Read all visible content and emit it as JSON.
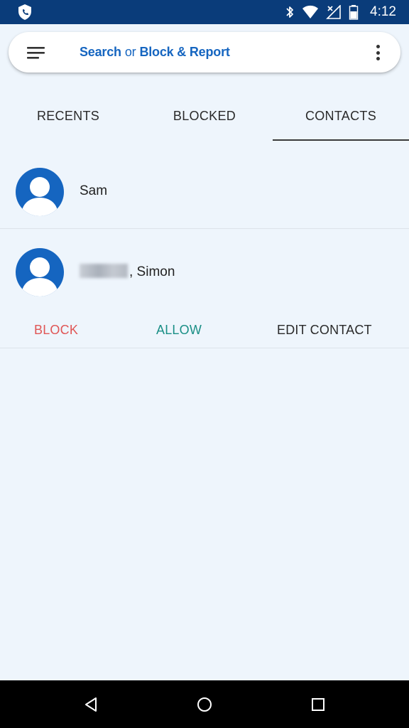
{
  "status_bar": {
    "time": "4:12",
    "icons": [
      "shield-app-icon",
      "bluetooth-icon",
      "wifi-icon",
      "no-signal-icon",
      "battery-icon"
    ],
    "background": "#0a3c7a"
  },
  "search_bar": {
    "search_label": "Search",
    "or_label": "or",
    "block_report_label": "Block & Report",
    "accent_color": "#1565c0"
  },
  "tabs": [
    {
      "label": "RECENTS",
      "active": false
    },
    {
      "label": "BLOCKED",
      "active": false
    },
    {
      "label": "CONTACTS",
      "active": true
    }
  ],
  "contacts": [
    {
      "name": "Sam",
      "expanded": false
    },
    {
      "name": ", Simon",
      "surname_redacted": true,
      "expanded": true
    }
  ],
  "actions": {
    "block_label": "BLOCK",
    "allow_label": "ALLOW",
    "edit_label": "EDIT CONTACT",
    "block_color": "#e05656",
    "allow_color": "#1a8f86"
  },
  "nav_bar": {
    "buttons": [
      "back-icon",
      "home-icon",
      "recents-icon"
    ]
  }
}
